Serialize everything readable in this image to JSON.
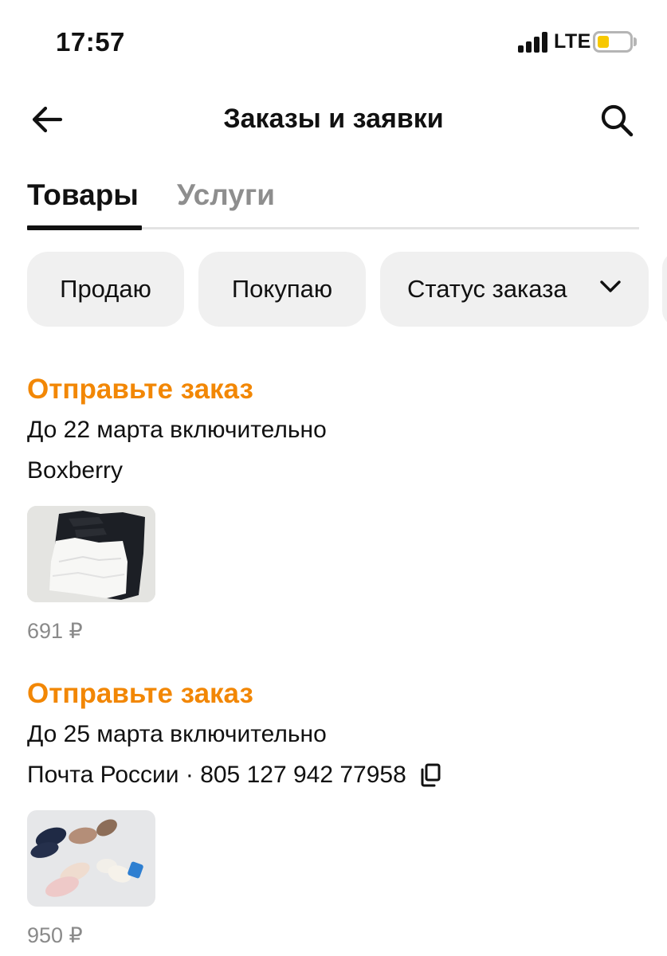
{
  "status_bar": {
    "time": "17:57",
    "network": "LTE",
    "battery_color": "#f7c800",
    "icons": [
      "signal-icon",
      "battery-icon"
    ]
  },
  "header": {
    "title": "Заказы и заявки",
    "back_icon": "arrow-left-icon",
    "search_icon": "search-icon"
  },
  "tabs": [
    {
      "label": "Товары",
      "active": true
    },
    {
      "label": "Услуги",
      "active": false
    }
  ],
  "filters": [
    {
      "label": "Продаю"
    },
    {
      "label": "Покупаю"
    },
    {
      "label": "Статус заказа",
      "icon": "chevron-down-icon"
    }
  ],
  "orders": [
    {
      "status": "Отправьте заказ",
      "deadline": "До 22 марта включительно",
      "delivery": "Boxberry",
      "photo": "clothes-photo",
      "price": "691 ₽"
    },
    {
      "status": "Отправьте заказ",
      "deadline": "До 25 марта включительно",
      "delivery": "Почта России · 805 127 942 77958",
      "delivery_icon": "copy-icon",
      "photo": "shoes-photo",
      "price": "950 ₽"
    }
  ],
  "colors": {
    "accent_orange": "#f28705",
    "chip_bg": "#f0f0f0",
    "muted_text": "#8a8a8a",
    "inactive_tab": "#8e8e8e"
  }
}
